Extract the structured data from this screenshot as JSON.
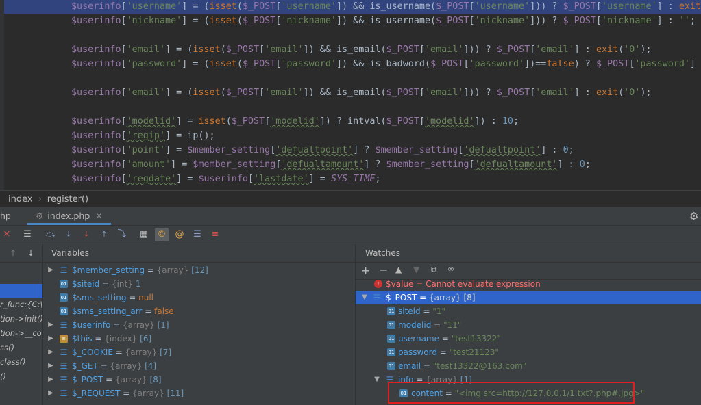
{
  "editor": {
    "lines": [
      {
        "tokens": [
          [
            "v",
            "$userinfo"
          ],
          [
            "f",
            "["
          ],
          [
            "s",
            "'username'"
          ],
          [
            "f",
            "] = ("
          ],
          [
            "k",
            "isset"
          ],
          [
            "f",
            "("
          ],
          [
            "v",
            "$_POST"
          ],
          [
            "f",
            "["
          ],
          [
            "s",
            "'username'"
          ],
          [
            "f",
            "]) && is_username("
          ],
          [
            "v",
            "$_POST"
          ],
          [
            "f",
            "["
          ],
          [
            "s",
            "'username'"
          ],
          [
            "f",
            "])) ? "
          ],
          [
            "v",
            "$_POST"
          ],
          [
            "f",
            "["
          ],
          [
            "s",
            "'username'"
          ],
          [
            "f",
            "] : "
          ],
          [
            "k",
            "exit"
          ],
          [
            "f",
            "("
          ]
        ]
      },
      {
        "tokens": [
          [
            "v",
            "$userinfo"
          ],
          [
            "f",
            "["
          ],
          [
            "s",
            "'nickname'"
          ],
          [
            "f",
            "] = ("
          ],
          [
            "k",
            "isset"
          ],
          [
            "f",
            "("
          ],
          [
            "v",
            "$_POST"
          ],
          [
            "f",
            "["
          ],
          [
            "s",
            "'nickname'"
          ],
          [
            "f",
            "]) && is_username("
          ],
          [
            "v",
            "$_POST"
          ],
          [
            "f",
            "["
          ],
          [
            "s",
            "'nickname'"
          ],
          [
            "f",
            "])) ? "
          ],
          [
            "v",
            "$_POST"
          ],
          [
            "f",
            "["
          ],
          [
            "s",
            "'nickname'"
          ],
          [
            "f",
            "] : "
          ],
          [
            "s",
            "''"
          ],
          [
            "f",
            ";"
          ]
        ]
      },
      {
        "tokens": []
      },
      {
        "tokens": [
          [
            "v",
            "$userinfo"
          ],
          [
            "f",
            "["
          ],
          [
            "s",
            "'email'"
          ],
          [
            "f",
            "] = ("
          ],
          [
            "k",
            "isset"
          ],
          [
            "f",
            "("
          ],
          [
            "v",
            "$_POST"
          ],
          [
            "f",
            "["
          ],
          [
            "s",
            "'email'"
          ],
          [
            "f",
            "]) && is_email("
          ],
          [
            "v",
            "$_POST"
          ],
          [
            "f",
            "["
          ],
          [
            "s",
            "'email'"
          ],
          [
            "f",
            "])) ? "
          ],
          [
            "v",
            "$_POST"
          ],
          [
            "f",
            "["
          ],
          [
            "s",
            "'email'"
          ],
          [
            "f",
            "] : "
          ],
          [
            "k",
            "exit"
          ],
          [
            "f",
            "("
          ],
          [
            "s",
            "'0'"
          ],
          [
            "f",
            ");"
          ]
        ]
      },
      {
        "tokens": [
          [
            "v",
            "$userinfo"
          ],
          [
            "f",
            "["
          ],
          [
            "s",
            "'password'"
          ],
          [
            "f",
            "] = ("
          ],
          [
            "k",
            "isset"
          ],
          [
            "f",
            "("
          ],
          [
            "v",
            "$_POST"
          ],
          [
            "f",
            "["
          ],
          [
            "s",
            "'password'"
          ],
          [
            "f",
            "]) && is_badword("
          ],
          [
            "v",
            "$_POST"
          ],
          [
            "f",
            "["
          ],
          [
            "s",
            "'password'"
          ],
          [
            "f",
            "])=="
          ],
          [
            "k",
            "false"
          ],
          [
            "f",
            ") ? "
          ],
          [
            "v",
            "$_POST"
          ],
          [
            "f",
            "["
          ],
          [
            "s",
            "'password'"
          ],
          [
            "f",
            "] :"
          ]
        ]
      },
      {
        "tokens": []
      },
      {
        "tokens": [
          [
            "v",
            "$userinfo"
          ],
          [
            "f",
            "["
          ],
          [
            "s",
            "'email'"
          ],
          [
            "f",
            "] = ("
          ],
          [
            "k",
            "isset"
          ],
          [
            "f",
            "("
          ],
          [
            "v",
            "$_POST"
          ],
          [
            "f",
            "["
          ],
          [
            "s",
            "'email'"
          ],
          [
            "f",
            "]) && is_email("
          ],
          [
            "v",
            "$_POST"
          ],
          [
            "f",
            "["
          ],
          [
            "s",
            "'email'"
          ],
          [
            "f",
            "])) ? "
          ],
          [
            "v",
            "$_POST"
          ],
          [
            "f",
            "["
          ],
          [
            "s",
            "'email'"
          ],
          [
            "f",
            "] : "
          ],
          [
            "k",
            "exit"
          ],
          [
            "f",
            "("
          ],
          [
            "s",
            "'0'"
          ],
          [
            "f",
            ");"
          ]
        ]
      },
      {
        "tokens": []
      },
      {
        "tokens": [
          [
            "v",
            "$userinfo"
          ],
          [
            "f",
            "["
          ],
          [
            "su",
            "'modelid'"
          ],
          [
            "f",
            "] = "
          ],
          [
            "k",
            "isset"
          ],
          [
            "f",
            "("
          ],
          [
            "v",
            "$_POST"
          ],
          [
            "f",
            "["
          ],
          [
            "su",
            "'modelid'"
          ],
          [
            "f",
            "]) ? intval("
          ],
          [
            "v",
            "$_POST"
          ],
          [
            "f",
            "["
          ],
          [
            "su",
            "'modelid'"
          ],
          [
            "f",
            "]) : "
          ],
          [
            "n",
            "10"
          ],
          [
            "f",
            ";"
          ]
        ]
      },
      {
        "tokens": [
          [
            "v",
            "$userinfo"
          ],
          [
            "f",
            "["
          ],
          [
            "su",
            "'regip'"
          ],
          [
            "f",
            "] = ip();"
          ]
        ]
      },
      {
        "tokens": [
          [
            "v",
            "$userinfo"
          ],
          [
            "f",
            "["
          ],
          [
            "s",
            "'point'"
          ],
          [
            "f",
            "] = "
          ],
          [
            "v",
            "$member_setting"
          ],
          [
            "f",
            "["
          ],
          [
            "su",
            "'defualtpoint'"
          ],
          [
            "f",
            "] ? "
          ],
          [
            "v",
            "$member_setting"
          ],
          [
            "f",
            "["
          ],
          [
            "su",
            "'defualtpoint'"
          ],
          [
            "f",
            "] : "
          ],
          [
            "n",
            "0"
          ],
          [
            "f",
            ";"
          ]
        ]
      },
      {
        "tokens": [
          [
            "v",
            "$userinfo"
          ],
          [
            "f",
            "["
          ],
          [
            "s",
            "'amount'"
          ],
          [
            "f",
            "] = "
          ],
          [
            "v",
            "$member_setting"
          ],
          [
            "f",
            "["
          ],
          [
            "su",
            "'defualtamount'"
          ],
          [
            "f",
            "] ? "
          ],
          [
            "v",
            "$member_setting"
          ],
          [
            "f",
            "["
          ],
          [
            "su",
            "'defualtamount'"
          ],
          [
            "f",
            "] : "
          ],
          [
            "n",
            "0"
          ],
          [
            "f",
            ";"
          ]
        ]
      },
      {
        "tokens": [
          [
            "v",
            "$userinfo"
          ],
          [
            "f",
            "["
          ],
          [
            "su",
            "'regdate'"
          ],
          [
            "f",
            "] = "
          ],
          [
            "v",
            "$userinfo"
          ],
          [
            "f",
            "["
          ],
          [
            "su",
            "'lastdate'"
          ],
          [
            "f",
            "] = "
          ],
          [
            "c",
            "SYS_TIME"
          ],
          [
            "f",
            ";"
          ]
        ]
      }
    ]
  },
  "breadcrumb": {
    "first": "index",
    "second": "register()"
  },
  "tabs": {
    "left": "hp",
    "active": "index.php"
  },
  "panels": {
    "variables_title": "Variables",
    "watches_title": "Watches"
  },
  "frames": [
    "r_func:{C:\\p",
    "tion->init()",
    "tion->__cor",
    "ss()",
    "class()",
    "()"
  ],
  "variables": [
    {
      "name": "$member_setting",
      "value": "{array} [12]",
      "icon": "list",
      "expand": true
    },
    {
      "name": "$siteid",
      "value": "{int} 1",
      "icon": "prim",
      "expand": false
    },
    {
      "name": "$sms_setting",
      "value": "null",
      "icon": "prim",
      "expand": false
    },
    {
      "name": "$sms_setting_arr",
      "value": "false",
      "icon": "prim",
      "expand": false
    },
    {
      "name": "$userinfo",
      "value": "{array} [1]",
      "icon": "list",
      "expand": true
    },
    {
      "name": "$this",
      "value": "{index} [6]",
      "icon": "obj",
      "expand": true
    },
    {
      "name": "$_COOKIE",
      "value": "{array} [7]",
      "icon": "list",
      "expand": true
    },
    {
      "name": "$_GET",
      "value": "{array} [4]",
      "icon": "list",
      "expand": true
    },
    {
      "name": "$_POST",
      "value": "{array} [8]",
      "icon": "list",
      "expand": true
    },
    {
      "name": "$_REQUEST",
      "value": "{array} [11]",
      "icon": "list",
      "expand": true
    }
  ],
  "watches": {
    "error": {
      "name": "$value",
      "value": "Cannot evaluate expression"
    },
    "post": {
      "name": "$_POST",
      "value": "{array} [8]"
    },
    "items": [
      {
        "name": "siteid",
        "value": "\"1\""
      },
      {
        "name": "modelid",
        "value": "\"11\""
      },
      {
        "name": "username",
        "value": "\"test13322\""
      },
      {
        "name": "password",
        "value": "\"test21123\""
      },
      {
        "name": "email",
        "value": "\"test13322@163.com\""
      }
    ],
    "info": {
      "name": "info",
      "value": "{array} [1]"
    },
    "content": {
      "name": "content",
      "value": "\"<img src=http://127.0.0.1/1.txt?.php#.jpg>\""
    }
  }
}
